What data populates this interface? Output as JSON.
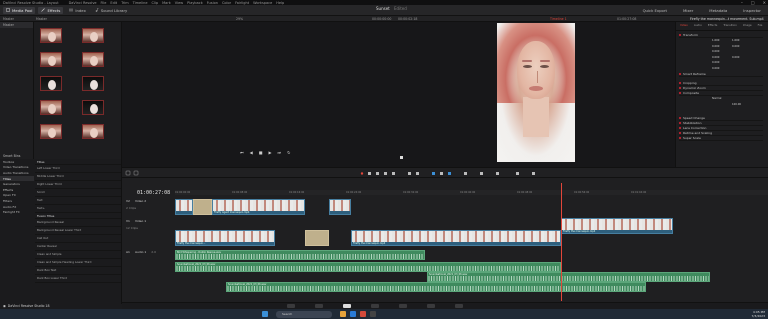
{
  "app": {
    "window_title": "DaVinci Resolve Studio - Layout",
    "menu": [
      "DaVinci Resolve",
      "File",
      "Edit",
      "Trim",
      "Timeline",
      "Clip",
      "Mark",
      "View",
      "Playback",
      "Fusion",
      "Color",
      "Fairlight",
      "Workspace",
      "Help"
    ],
    "project_name": "Sunset",
    "project_status": "Edited"
  },
  "toolbar": {
    "media_pool": "Media Pool",
    "effects": "Effects",
    "edit_index": "Index",
    "sound_library": "Sound Library",
    "right": [
      "Quick Export",
      "Mixer",
      "Metadata",
      "Inspector"
    ]
  },
  "viewer": {
    "zoom": "29%",
    "src_timecode": "00:00:00:00",
    "dur_timecode": "00:00:02:18",
    "timeline_name": "Timeline 1",
    "rec_timecode": "01:00:27:08",
    "clip_name": "Timeline 1"
  },
  "left_panel": {
    "header": "Master",
    "smart_bins": "Smart Bins",
    "bins": [
      "Keywords",
      "Collections"
    ]
  },
  "media": {
    "header": "Master",
    "thumbs": [
      {
        "dark": false,
        "label": ""
      },
      {
        "dark": false,
        "label": ""
      },
      {
        "dark": false,
        "label": ""
      },
      {
        "dark": false,
        "label": ""
      },
      {
        "dark": true,
        "label": ""
      },
      {
        "dark": true,
        "label": ""
      },
      {
        "dark": false,
        "label": ""
      },
      {
        "dark": true,
        "label": ""
      },
      {
        "dark": false,
        "label": ""
      },
      {
        "dark": false,
        "label": ""
      }
    ]
  },
  "inspector": {
    "clip_title": "Firefly the mannequin...t movement. Sub.mp4",
    "tabs": [
      "Video",
      "Audio",
      "Effects",
      "Transition",
      "Image",
      "File"
    ],
    "sections": [
      "Transform",
      "Smart Reframe",
      "Cropping",
      "Dynamic Zoom",
      "Composite",
      "Speed Change",
      "Stabilization",
      "Lens Correction",
      "Retime and Scaling",
      "Super Scale"
    ],
    "transform": {
      "zoom_x": "1.000",
      "zoom_y": "1.000",
      "position_x": "0.000",
      "position_y": "0.000",
      "rotation": "0.000",
      "anchor_x": "0.000",
      "anchor_y": "0.000",
      "pitch": "0.000",
      "yaw": "0.000"
    },
    "composite_mode": "Normal",
    "opacity": "100.00"
  },
  "toolbox": {
    "items": [
      "Toolbox",
      "Video Transitions",
      "Audio Transitions",
      "Titles",
      "Generators",
      "Effects",
      "Open FX",
      "Filters",
      "Audio FX",
      "Fairlight FX"
    ],
    "selected": "Titles"
  },
  "effects": {
    "header": "Titles",
    "items": [
      "Left Lower Third",
      "Middle Lower Third",
      "Right Lower Third",
      "Scroll",
      "Text",
      "Text+"
    ],
    "fusion_header": "Fusion Titles",
    "fusion_items": [
      "Background Reveal",
      "Background Reveal Lower Third",
      "Call Out",
      "Center Reveal",
      "Clean and Simple",
      "Clean and Simple Heading Lower Third",
      "Dark Box Text",
      "Dark Box Lower Third"
    ]
  },
  "timeline": {
    "timecode": "01:00:27:08",
    "ruler": [
      "01:00:00:00",
      "01:00:08:00",
      "01:00:16:00",
      "01:00:24:00",
      "01:00:32:00",
      "01:00:40:00",
      "01:00:48:00",
      "01:00:56:00",
      "01:01:04:00"
    ],
    "tracks": [
      {
        "id": "V2",
        "name": "Video 2",
        "clips": "2 Clips"
      },
      {
        "id": "V1",
        "name": "Video 1",
        "clips": "12 Clips"
      },
      {
        "id": "A1",
        "name": "Audio 1",
        "level": "2.0"
      }
    ],
    "video_clips": [
      "Firefly Agent mannequin.mp4",
      "Firefly the mannequin...",
      "Firefly the mannequin.mp4"
    ],
    "audio_clip": "Soundsational_2021_03_06.wav",
    "audio_clip2": "Bird Whispering - Dublin Rescue.wav"
  },
  "pages": [
    "Media",
    "Cut",
    "Edit",
    "Fusion",
    "Color",
    "Fairlight",
    "Deliver"
  ],
  "footer": {
    "app_label": "DaVinci Resolve Studio 18"
  },
  "taskbar": {
    "search": "Search",
    "time": "4:05 PM",
    "date": "7/3/2023"
  }
}
